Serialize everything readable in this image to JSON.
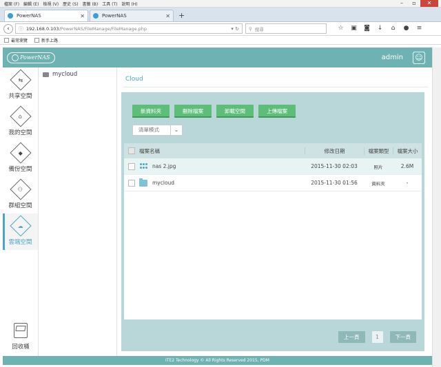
{
  "browser": {
    "menu": [
      "檔案 (F)",
      "編輯 (E)",
      "檢視 (V)",
      "歷史 (S)",
      "書籤 (B)",
      "工具 (T)",
      "說明 (H)"
    ],
    "tabs": [
      {
        "label": "PowerNAS"
      },
      {
        "label": "PowerNAS"
      }
    ],
    "url_host": "192.168.0.103",
    "url_path": "/PowerNAS/FileManage/FileManage.php",
    "search_placeholder": "搜尋",
    "bookmarks": [
      "最常瀏覽",
      "新手上路"
    ]
  },
  "header": {
    "logo": "PowerNAS",
    "user": "admin"
  },
  "sidebar": {
    "items": [
      {
        "label": "共享空間",
        "icon": "share"
      },
      {
        "label": "我的空間",
        "icon": "home"
      },
      {
        "label": "備份空間",
        "icon": "backup"
      },
      {
        "label": "群組空間",
        "icon": "group"
      },
      {
        "label": "雲端空間",
        "icon": "cloud"
      }
    ],
    "recycle": "回收桶"
  },
  "tree": {
    "items": [
      {
        "label": "mycloud"
      }
    ]
  },
  "main": {
    "breadcrumb": "Cloud",
    "buttons": [
      "新資料夾",
      "刪除檔案",
      "卸載空間",
      "上傳檔案"
    ],
    "view_mode": "清單模式",
    "columns": {
      "name": "檔案名稱",
      "date": "修改日期",
      "type": "檔案類型",
      "size": "檔案大小"
    },
    "rows": [
      {
        "name": "nas 2.jpg",
        "date": "2015-11-30 02:03",
        "type": "照片",
        "size": "2.6M",
        "icon": "image"
      },
      {
        "name": "mycloud",
        "date": "2015-11-30 01:56",
        "type": "資料夾",
        "size": "-",
        "icon": "folder"
      }
    ],
    "pager": {
      "prev": "上一頁",
      "page": "1",
      "next": "下一頁"
    }
  },
  "footer": "ITE2 Technology © All Rights Reserved 2015, PDM",
  "colors": {
    "accent": "#6fb2b4",
    "button": "#5fbd7a",
    "highlight": "#4ba5c6"
  }
}
